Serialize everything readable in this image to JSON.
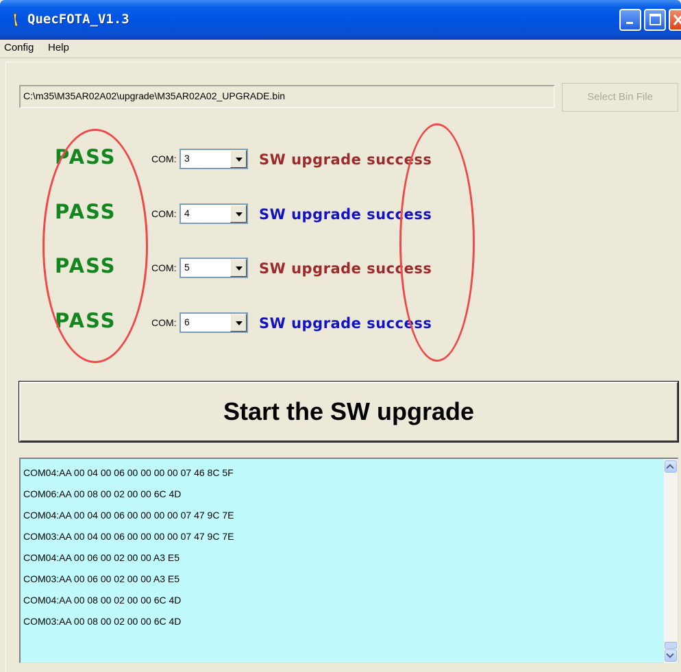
{
  "window": {
    "title": "QuecFOTA_V1.3",
    "accent": "#0054e3"
  },
  "menu": {
    "items": [
      "Config",
      "Help"
    ]
  },
  "file": {
    "path": "C:\\m35\\M35AR02A02\\upgrade\\M35AR02A02_UPGRADE.bin",
    "select_label": "Select Bin File"
  },
  "rows": [
    {
      "result": "PASS",
      "com_label": "COM:",
      "com_value": "3",
      "status": "SW upgrade success",
      "status_color": "#9c2a2a"
    },
    {
      "result": "PASS",
      "com_label": "COM:",
      "com_value": "4",
      "status": "SW upgrade success",
      "status_color": "#1212c4"
    },
    {
      "result": "PASS",
      "com_label": "COM:",
      "com_value": "5",
      "status": "SW upgrade success",
      "status_color": "#9c2a2a"
    },
    {
      "result": "PASS",
      "com_label": "COM:",
      "com_value": "6",
      "status": "SW upgrade success",
      "status_color": "#1212c4"
    }
  ],
  "start_button": {
    "label": "Start the SW upgrade"
  },
  "log": {
    "lines": [
      "COM04:AA 00 04 00 06 00 00 00 00 07 46 8C 5F",
      "COM06:AA 00 08 00 02 00 00 6C 4D",
      "COM04:AA 00 04 00 06 00 00 00 00 07 47 9C 7E",
      "COM03:AA 00 04 00 06 00 00 00 00 07 47 9C 7E",
      "COM04:AA 00 06 00 02 00 00 A3 E5",
      "COM03:AA 00 06 00 02 00 00 A3 E5",
      "COM04:AA 00 08 00 02 00 00 6C 4D",
      "COM03:AA 00 08 00 02 00 00 6C 4D"
    ],
    "background": "#c0fafc"
  },
  "annotation": {
    "oval_color": "#f04848"
  }
}
